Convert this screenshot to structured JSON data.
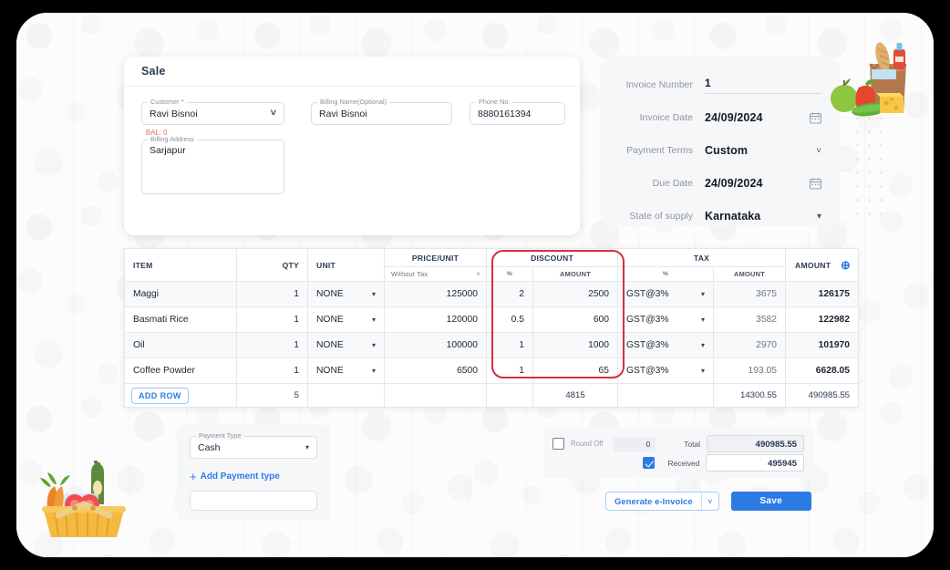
{
  "sale_card": {
    "title": "Sale",
    "customer": {
      "legend": "Customer",
      "required_mark": "*",
      "value": "Ravi Bisnoi",
      "balance": "BAL: 0"
    },
    "billing_name": {
      "legend": "Billing Name(Optional)",
      "value": "Ravi Bisnoi"
    },
    "phone": {
      "legend": "Phone No.",
      "value": "8880161394"
    },
    "billing_address": {
      "legend": "Billing Address",
      "value": "Sarjapur"
    }
  },
  "invoice_panel": {
    "rows": [
      {
        "label": "Invoice Number",
        "value": "1",
        "control": "underline"
      },
      {
        "label": "Invoice Date",
        "value": "24/09/2024",
        "control": "calendar"
      },
      {
        "label": "Payment Terms",
        "value": "Custom",
        "control": "chevron"
      },
      {
        "label": "Due Date",
        "value": "24/09/2024",
        "control": "calendar"
      },
      {
        "label": "State of supply",
        "value": "Karnataka",
        "control": "caret"
      }
    ]
  },
  "items_table": {
    "headers": {
      "item": "ITEM",
      "qty": "QTY",
      "unit": "UNIT",
      "price_unit": "PRICE/UNIT",
      "price_unit_sub": "Without Tax",
      "discount": "DISCOUNT",
      "discount_pct": "%",
      "discount_amount": "AMOUNT",
      "tax": "TAX",
      "tax_pct": "%",
      "tax_amount": "AMOUNT",
      "amount": "AMOUNT"
    },
    "rows": [
      {
        "item": "Maggi",
        "qty": "1",
        "unit": "NONE",
        "price_unit": "125000",
        "discount_pct": "2",
        "discount_amount": "2500",
        "tax_pct": "GST@3%",
        "tax_amount": "3675",
        "amount": "126175"
      },
      {
        "item": "Basmati Rice",
        "qty": "1",
        "unit": "NONE",
        "price_unit": "120000",
        "discount_pct": "0.5",
        "discount_amount": "600",
        "tax_pct": "GST@3%",
        "tax_amount": "3582",
        "amount": "122982"
      },
      {
        "item": "Oil",
        "qty": "1",
        "unit": "NONE",
        "price_unit": "100000",
        "discount_pct": "1",
        "discount_amount": "1000",
        "tax_pct": "GST@3%",
        "tax_amount": "2970",
        "amount": "101970"
      },
      {
        "item": "Coffee Powder",
        "qty": "1",
        "unit": "NONE",
        "price_unit": "6500",
        "discount_pct": "1",
        "discount_amount": "65",
        "tax_pct": "GST@3%",
        "tax_amount": "193.05",
        "amount": "6628.05"
      }
    ],
    "footer": {
      "add_row": "ADD ROW",
      "qty_total": "5",
      "discount_total": "4815",
      "tax_total": "14300.55",
      "amount_total": "490985.55"
    }
  },
  "payment": {
    "payment_type_legend": "Payment Type",
    "payment_type_value": "Cash",
    "add_payment_type": "Add Payment type",
    "add_payment_plus": "+"
  },
  "totals": {
    "round_off_label": "Round Off",
    "round_off_value": "0",
    "round_off_checked": false,
    "total_label": "Total",
    "total_value": "490985.55",
    "received_label": "Received",
    "received_value": "495945",
    "received_checked": true
  },
  "actions": {
    "generate_einvoice": "Generate e-Invoice",
    "save": "Save"
  },
  "colors": {
    "accent_blue": "#2c7be5",
    "highlight_red": "#d32f45",
    "balance_red": "#ef6b62",
    "panel_gray": "#f6f7f9",
    "heading_navy": "#2b3a55"
  }
}
